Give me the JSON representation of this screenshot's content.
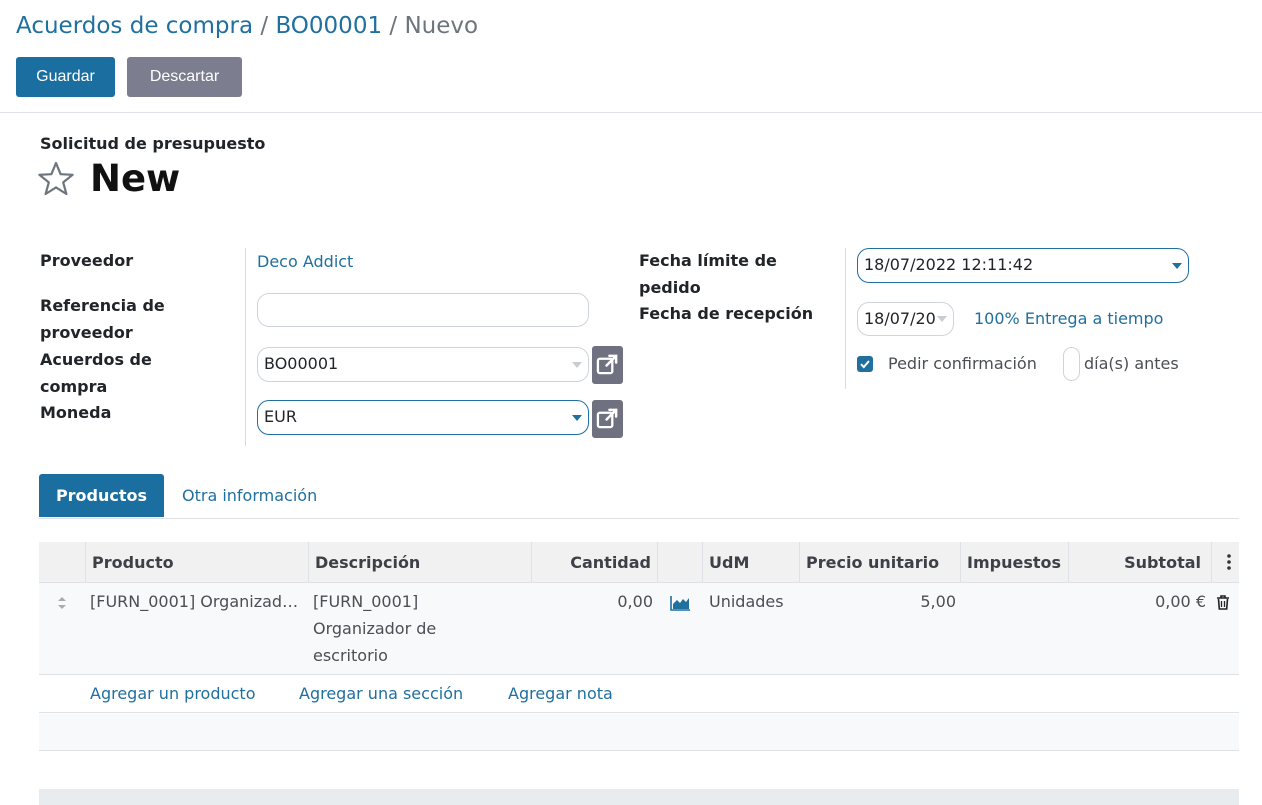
{
  "breadcrumb": {
    "parent": "Acuerdos de compra",
    "record": "BO00001",
    "current": "Nuevo",
    "separator": "/"
  },
  "actions": {
    "save": "Guardar",
    "discard": "Descartar"
  },
  "header": {
    "subtitle": "Solicitud de presupuesto",
    "name": "New"
  },
  "form": {
    "vendor_label": "Proveedor",
    "vendor_value": "Deco Addict",
    "vendor_ref_label_1": "Referencia de",
    "vendor_ref_label_2": "proveedor",
    "vendor_ref_value": "",
    "agreement_label_1": "Acuerdos de",
    "agreement_label_2": "compra",
    "agreement_value": "BO00001",
    "currency_label": "Moneda",
    "currency_value": "EUR",
    "deadline_label_1": "Fecha límite de",
    "deadline_label_2": "pedido",
    "deadline_value": "18/07/2022 12:11:42",
    "receipt_label": "Fecha de recepción",
    "receipt_value": "18/07/20",
    "on_time": "100% Entrega a tiempo",
    "ask_confirm": "Pedir confirmación",
    "days_before": "día(s) antes",
    "ask_confirm_checked": true
  },
  "tabs": [
    {
      "label": "Productos",
      "active": true
    },
    {
      "label": "Otra información",
      "active": false
    }
  ],
  "table": {
    "columns": [
      "Producto",
      "Descripción",
      "Cantidad",
      "",
      "UdM",
      "Precio unitario",
      "Impuestos",
      "Subtotal"
    ],
    "rows": [
      {
        "product": "[FURN_0001] Organizador de escritorio",
        "description_1": "[FURN_0001]",
        "description_2": "Organizador de",
        "description_3": "escritorio",
        "quantity": "0,00",
        "uom": "Unidades",
        "price": "5,00",
        "taxes": "",
        "subtotal": "0,00 €"
      }
    ],
    "add_product": "Agregar un producto",
    "add_section": "Agregar una sección",
    "add_note": "Agregar nota"
  },
  "colors": {
    "primary": "#1b6fa0",
    "secondary": "#7c7d8f",
    "link": "#1f6f9f"
  }
}
